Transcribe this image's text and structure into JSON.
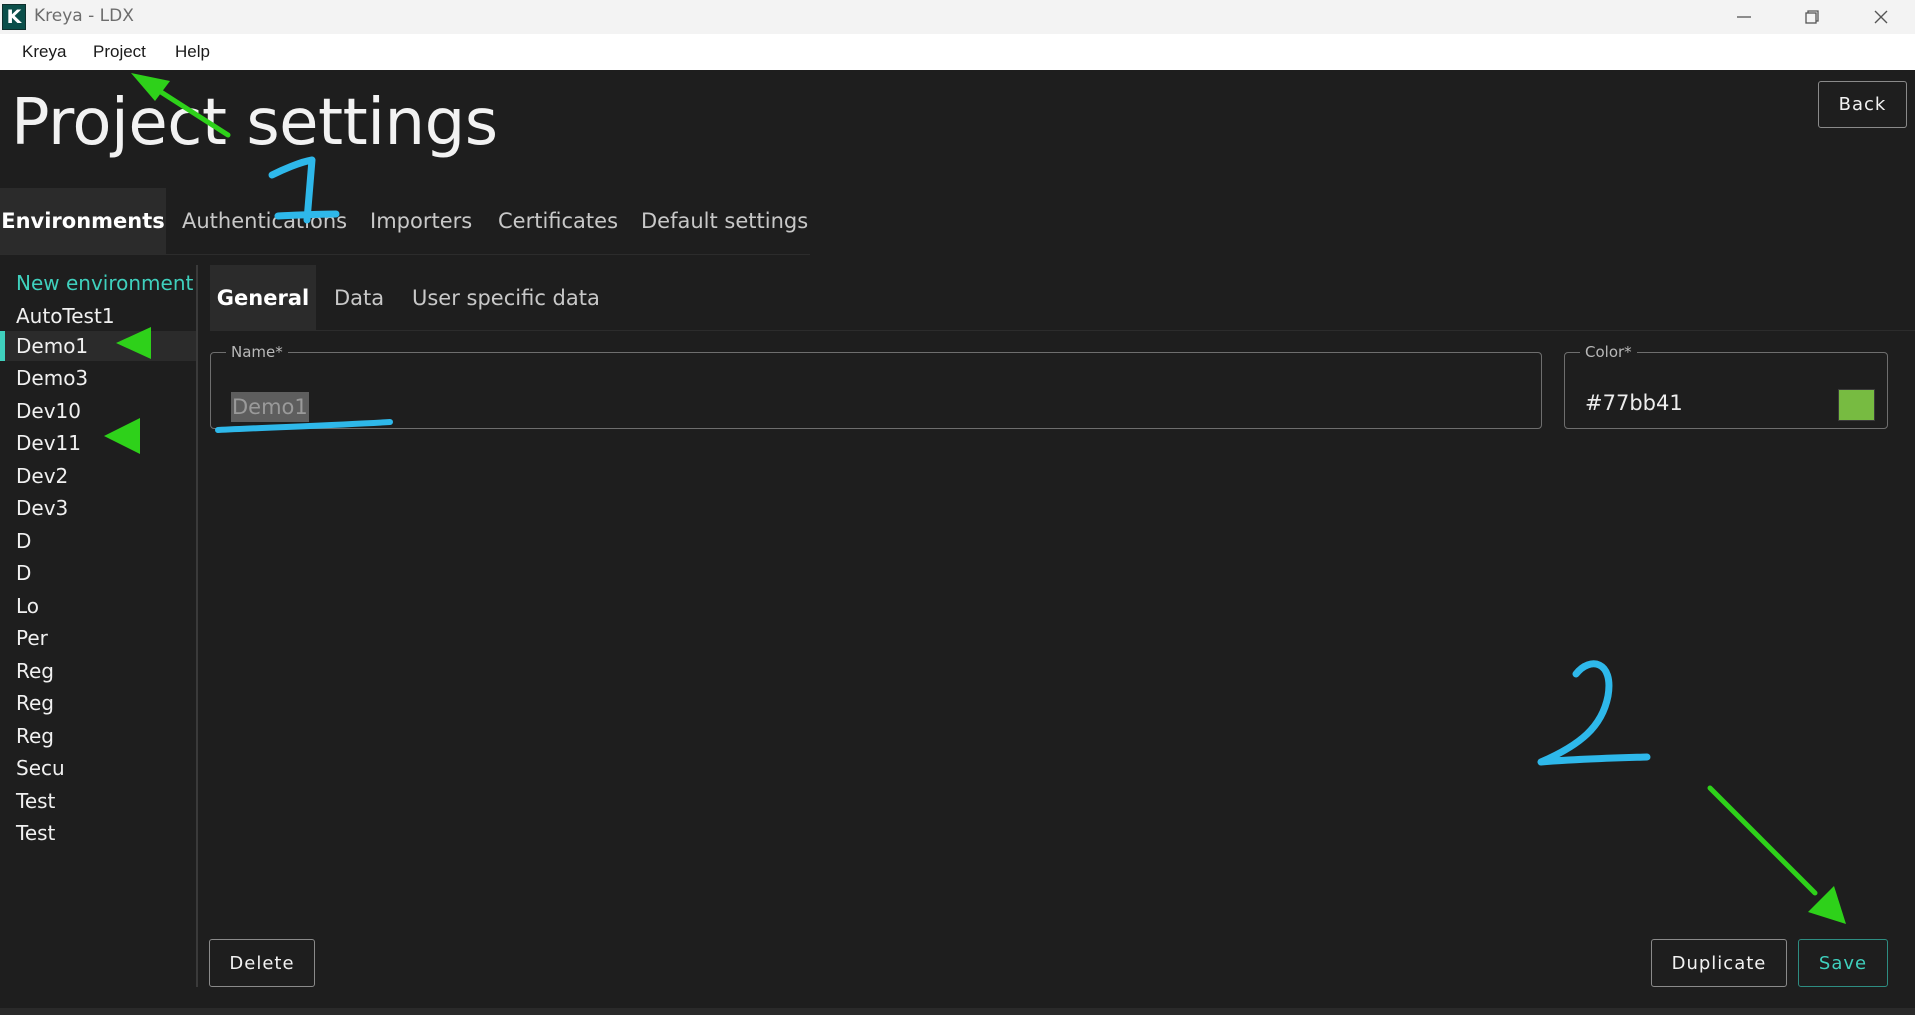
{
  "window": {
    "title": "Kreya - LDX",
    "logo_letter": "K"
  },
  "menu": {
    "items": [
      "Kreya",
      "Project",
      "Help"
    ]
  },
  "page": {
    "title": "Project settings",
    "back_label": "Back"
  },
  "top_tabs": [
    "Environments",
    "Authentications",
    "Importers",
    "Certificates",
    "Default settings"
  ],
  "environments": {
    "new_label": "New environment",
    "items": [
      "AutoTest1",
      "Demo1",
      "Demo3",
      "Dev10",
      "Dev11",
      "Dev2",
      "Dev3",
      "D",
      "D",
      "Lo",
      "Per",
      "Reg",
      "Reg",
      "Reg",
      "Secu",
      "Test",
      "Test"
    ],
    "selected": "Demo1"
  },
  "sub_tabs": [
    "General",
    "Data",
    "User specific data"
  ],
  "form": {
    "name_label": "Name*",
    "name_value": "Demo1",
    "color_label": "Color*",
    "color_value": "#77bb41"
  },
  "actions": {
    "delete_label": "Delete",
    "duplicate_label": "Duplicate",
    "save_label": "Save"
  },
  "colors": {
    "accent": "#3fd0bd",
    "swatch": "#77bb41",
    "annotation_green": "#2ed11a",
    "annotation_blue": "#2eb8ea"
  }
}
